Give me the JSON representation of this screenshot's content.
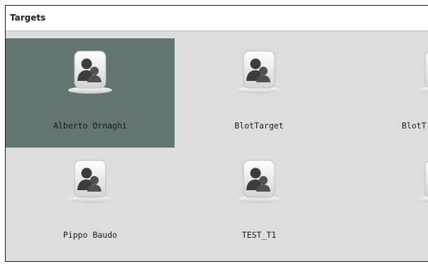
{
  "panel": {
    "title": "Targets"
  },
  "targets": [
    {
      "label": "Alberto Ornaghi",
      "icon": "target-user-icon",
      "selected": true
    },
    {
      "label": "BlotTarget",
      "icon": "target-user-icon",
      "selected": false
    },
    {
      "label": "BlotT",
      "icon": "target-user-icon",
      "selected": false
    },
    {
      "label": "Pippo Baudo",
      "icon": "target-user-icon",
      "selected": false
    },
    {
      "label": "TEST_T1",
      "icon": "target-user-icon",
      "selected": false
    },
    {
      "label": "",
      "icon": "target-user-icon",
      "selected": false
    }
  ],
  "colors": {
    "selected_tile": "#637473",
    "panel_background": "#dcdedd"
  }
}
